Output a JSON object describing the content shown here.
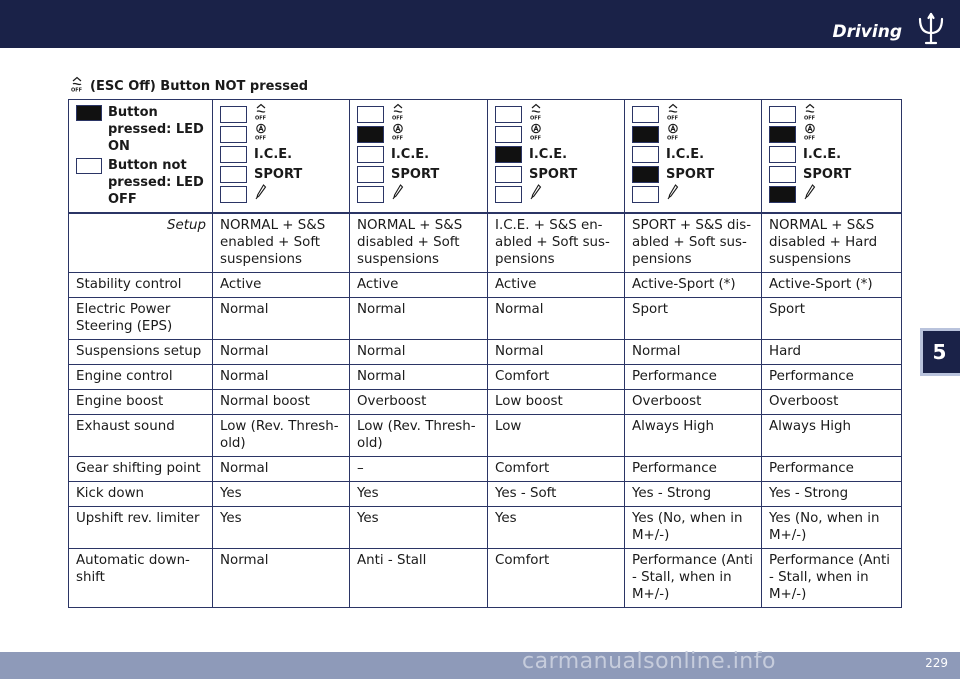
{
  "header": {
    "section_title": "Driving"
  },
  "chapter": {
    "number": "5"
  },
  "footer": {
    "page_number": "229",
    "watermark": "carmanualsonline.info"
  },
  "heading": {
    "esc_icon": "esc-off-icon",
    "text": "(ESC Off) Button NOT pressed"
  },
  "legend": {
    "on_text": "Button pressed: LED ON",
    "off_text": "Button not pressed: LED OFF"
  },
  "mode_labels": {
    "ice": "I.C.E.",
    "sport": "SPORT"
  },
  "led_icons": [
    "esc-off-icon",
    "suspension-off-icon",
    "ice-text",
    "sport-text",
    "manual-gear-icon"
  ],
  "columns": [
    {
      "leds": [
        false,
        false,
        false,
        false,
        false
      ]
    },
    {
      "leds": [
        false,
        true,
        false,
        false,
        false
      ]
    },
    {
      "leds": [
        false,
        false,
        true,
        false,
        false
      ]
    },
    {
      "leds": [
        false,
        true,
        false,
        true,
        false
      ]
    },
    {
      "leds": [
        false,
        true,
        false,
        false,
        true
      ]
    }
  ],
  "rows": [
    {
      "label": "Setup",
      "values": [
        "NORMAL + S&S enabled + Soft suspensions",
        "NORMAL + S&S disabled + Soft suspensions",
        "I.C.E. + S&S en-abled + Soft sus-pensions",
        "SPORT + S&S dis-abled + Soft sus-pensions",
        "NORMAL + S&S disabled + Hard suspensions"
      ]
    },
    {
      "label": "Stability control",
      "values": [
        "Active",
        "Active",
        "Active",
        "Active-Sport (*)",
        "Active-Sport (*)"
      ]
    },
    {
      "label": "Electric Power Steering (EPS)",
      "values": [
        "Normal",
        "Normal",
        "Normal",
        "Sport",
        "Sport"
      ]
    },
    {
      "label": "Suspensions setup",
      "values": [
        "Normal",
        "Normal",
        "Normal",
        "Normal",
        "Hard"
      ]
    },
    {
      "label": "Engine control",
      "values": [
        "Normal",
        "Normal",
        "Comfort",
        "Performance",
        "Performance"
      ]
    },
    {
      "label": "Engine boost",
      "values": [
        "Normal boost",
        "Overboost",
        "Low boost",
        "Overboost",
        "Overboost"
      ]
    },
    {
      "label": "Exhaust sound",
      "values": [
        "Low (Rev. Thresh-old)",
        "Low (Rev. Thresh-old)",
        "Low",
        "Always High",
        "Always High"
      ]
    },
    {
      "label": "Gear shifting point",
      "values": [
        "Normal",
        "–",
        "Comfort",
        "Performance",
        "Performance"
      ]
    },
    {
      "label": "Kick down",
      "values": [
        "Yes",
        "Yes",
        "Yes - Soft",
        "Yes - Strong",
        "Yes - Strong"
      ]
    },
    {
      "label": "Upshift rev. limiter",
      "values": [
        "Yes",
        "Yes",
        "Yes",
        "Yes (No, when in M+/-)",
        "Yes (No, when in M+/-)"
      ]
    },
    {
      "label": "Automatic down-shift",
      "values": [
        "Normal",
        "Anti - Stall",
        "Comfort",
        "Performance (Anti - Stall, when in M+/-)",
        "Performance (Anti - Stall, when in M+/-)"
      ]
    }
  ],
  "colors": {
    "navy": "#1a2248",
    "border": "#2b3565",
    "footer": "#8e9ab9",
    "led_on": "#111111"
  }
}
